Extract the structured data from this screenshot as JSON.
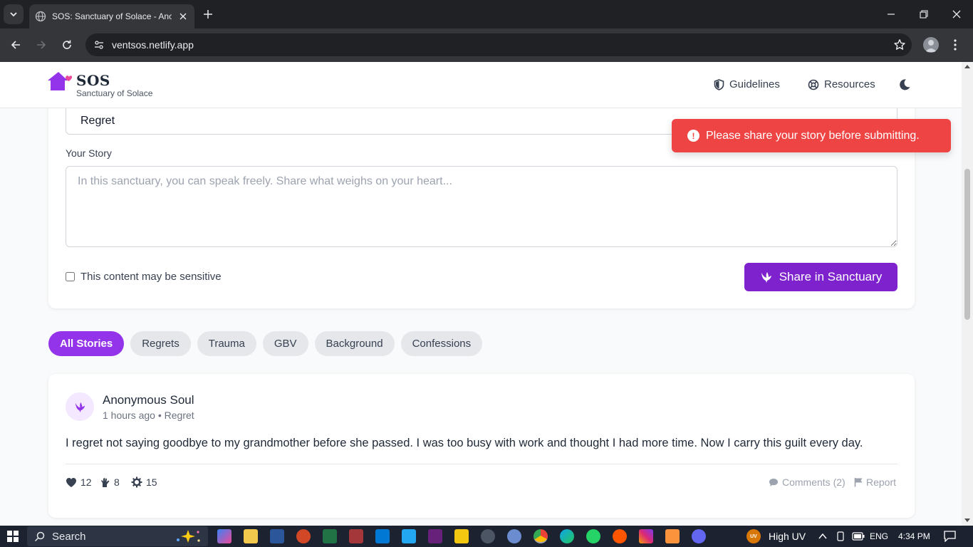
{
  "browser": {
    "tab_title": "SOS: Sanctuary of Solace - Anonymous Stories",
    "url": "ventsos.netlify.app"
  },
  "header": {
    "brand": "SOS",
    "tagline": "Sanctuary of Solace",
    "nav": [
      {
        "label": "Guidelines",
        "icon": "shield-icon"
      },
      {
        "label": "Resources",
        "icon": "lifebuoy-icon"
      }
    ],
    "theme_icon": "moon-icon"
  },
  "form": {
    "category_value": "Regret",
    "story_label": "Your Story",
    "story_placeholder": "In this sanctuary, you can speak freely. Share what weighs on your heart...",
    "story_value": "",
    "sensitive_label": "This content may be sensitive",
    "sensitive_checked": false,
    "submit_label": "Share in Sanctuary"
  },
  "toast": {
    "message": "Please share your story before submitting.",
    "type": "error"
  },
  "filters": {
    "active": "All Stories",
    "items": [
      "All Stories",
      "Regrets",
      "Trauma",
      "GBV",
      "Background",
      "Confessions"
    ]
  },
  "stories": [
    {
      "author": "Anonymous Soul",
      "time": "1 hours ago",
      "category": "Regret",
      "text": "I regret not saying goodbye to my grandmother before she passed. I was too busy with work and thought I had more time. Now I carry this guilt every day.",
      "reactions": {
        "heart": "12",
        "hug": "8",
        "support": "15"
      },
      "comments_label": "Comments (2)",
      "report_label": "Report"
    }
  ],
  "taskbar": {
    "search_label": "Search",
    "weather_badge": "UV",
    "weather": "High UV",
    "language": "ENG",
    "time": "4:34 PM"
  },
  "colors": {
    "accent": "#7e22ce",
    "chip_active": "#9333ea",
    "toast_error": "#ef4444",
    "logo": "#9333ea"
  }
}
